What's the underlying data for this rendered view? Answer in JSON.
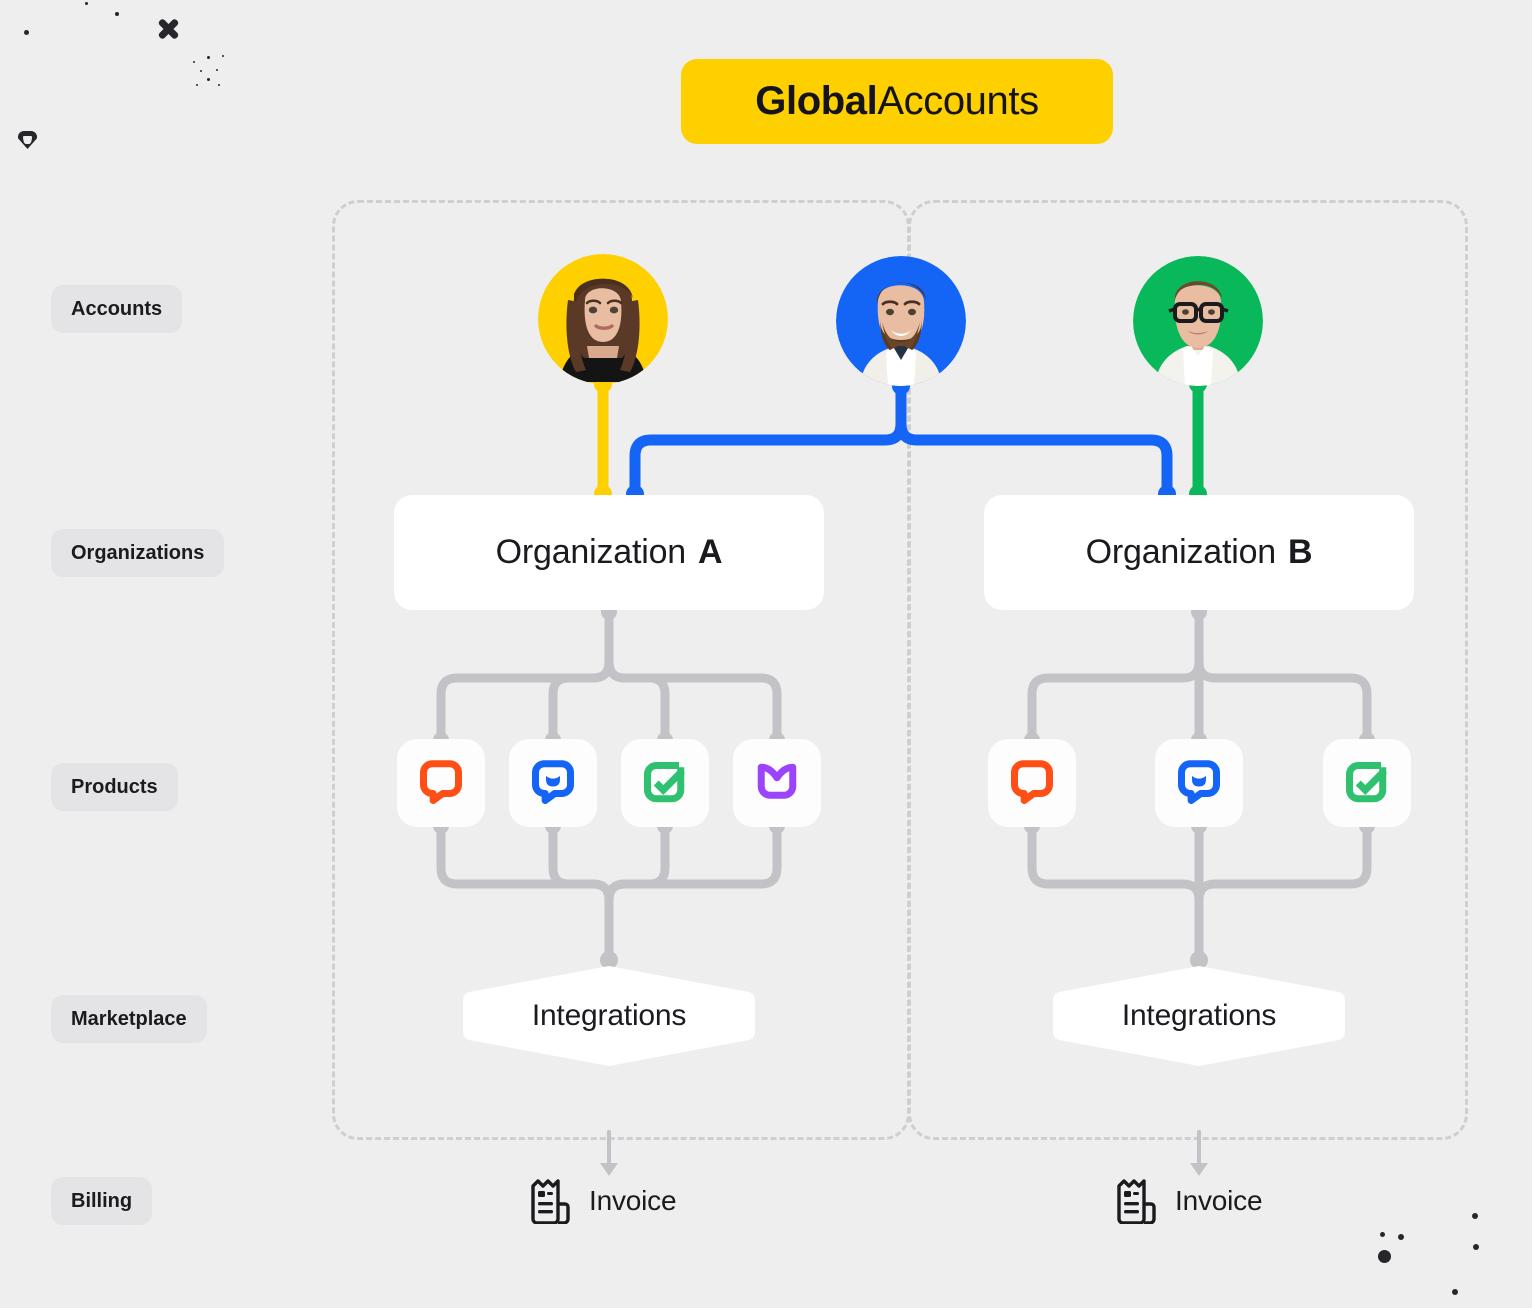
{
  "title": {
    "bold": "Global",
    "rest": " Accounts",
    "badge_color": "#ffd000"
  },
  "row_labels": [
    {
      "key": "accounts",
      "label": "Accounts"
    },
    {
      "key": "organizations",
      "label": "Organizations"
    },
    {
      "key": "products",
      "label": "Products"
    },
    {
      "key": "marketplace",
      "label": "Marketplace"
    },
    {
      "key": "billing",
      "label": "Billing"
    }
  ],
  "accounts": [
    {
      "id": "account-1",
      "avatar": "woman-brown-hair",
      "ring_color": "#ffd000",
      "link_color": "#ffd000"
    },
    {
      "id": "account-2",
      "avatar": "bearded-man",
      "ring_color": "#1464f6",
      "link_color": "#1464f6"
    },
    {
      "id": "account-3",
      "avatar": "man-with-glasses",
      "ring_color": "#09b85a",
      "link_color": "#09b85a"
    }
  ],
  "organizations": [
    {
      "id": "organization-a",
      "name": "Organization",
      "letter": "A",
      "products": [
        {
          "id": "helpdesk",
          "icon": "speech-bubble-icon",
          "color": "#ff4f17"
        },
        {
          "id": "livechat",
          "icon": "chat-smile-icon",
          "color": "#1464f6"
        },
        {
          "id": "chatbot",
          "icon": "check-box-icon",
          "color": "#2fc070"
        },
        {
          "id": "knowledgebase",
          "icon": "open-book-icon",
          "color": "#9b44fc"
        }
      ],
      "marketplace": {
        "label": "Integrations"
      },
      "billing": {
        "label": "Invoice",
        "icon": "invoice-icon"
      }
    },
    {
      "id": "organization-b",
      "name": "Organization",
      "letter": "B",
      "products": [
        {
          "id": "helpdesk",
          "icon": "speech-bubble-icon",
          "color": "#ff4f17"
        },
        {
          "id": "livechat",
          "icon": "chat-smile-icon",
          "color": "#1464f6"
        },
        {
          "id": "chatbot",
          "icon": "check-box-icon",
          "color": "#2fc070"
        }
      ],
      "marketplace": {
        "label": "Integrations"
      },
      "billing": {
        "label": "Invoice",
        "icon": "invoice-icon"
      }
    }
  ],
  "colors": {
    "background": "#eeeeee",
    "label_pill": "#e4e4e6",
    "card": "#ffffff",
    "wire_gray": "#c3c3c7",
    "dashed_border": "#cfcfd3"
  }
}
